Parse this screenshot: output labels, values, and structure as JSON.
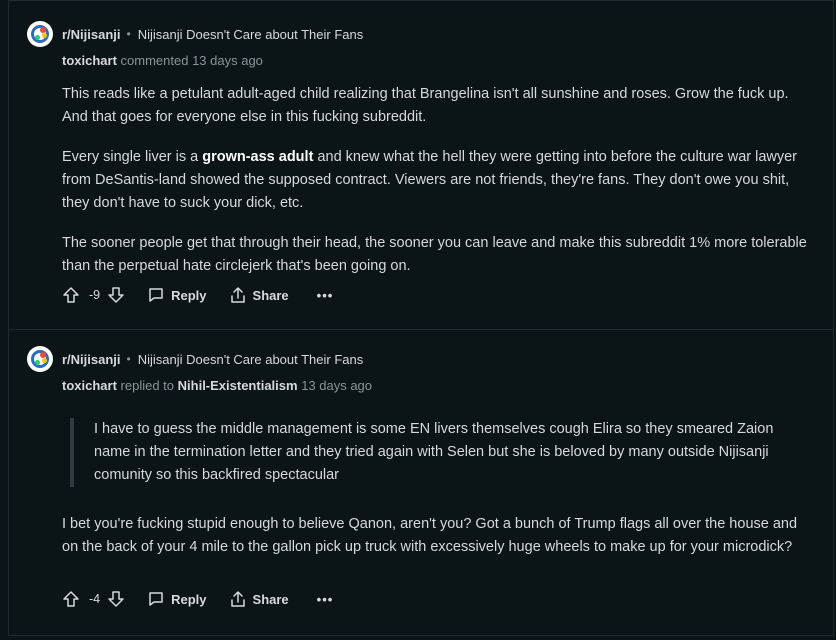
{
  "comments": [
    {
      "subreddit": "r/Nijisanji",
      "separator": "•",
      "post_title": "Nijisanji Doesn't Care about Their Fans",
      "author": "toxichart",
      "action": "commented",
      "target": "",
      "time": "13 days ago",
      "quote": [],
      "paragraphs": [
        {
          "before": "This reads like a petulant adult-aged child realizing that Brangelina isn't all sunshine and roses. Grow the fuck up. And that goes for everyone else in this fucking subreddit.",
          "bold": "",
          "after": ""
        },
        {
          "before": "Every single liver is a ",
          "bold": "grown-ass adult",
          "after": " and knew what the hell they were getting into before the culture war lawyer from DeSantis-land showed the supposed contract. Viewers are not friends, they're fans. They don't owe you shit, they don't have to suck your dick, etc."
        },
        {
          "before": "The sooner people get that through their head, the sooner you can leave and make this subreddit 1% more tolerable than the perpetual hate circlejerk that's been going on.",
          "bold": "",
          "after": ""
        }
      ],
      "score": "-9",
      "reply_label": "Reply",
      "share_label": "Share",
      "more_label": "•••"
    },
    {
      "subreddit": "r/Nijisanji",
      "separator": "•",
      "post_title": "Nijisanji Doesn't Care about Their Fans",
      "author": "toxichart",
      "action": "replied to",
      "target": "Nihil-Existentialism",
      "time": "13 days ago",
      "quote": [
        "I have to guess the middle management is some EN livers themselves cough Elira so they smeared Zaion name in the termination letter and they tried again with Selen but she is beloved by many outside Nijisanji comunity so this backfired spectacular"
      ],
      "paragraphs": [
        {
          "before": "I bet you're fucking stupid enough to believe Qanon, aren't you? Got a bunch of Trump flags all over the house and on the back of your 4 mile to the gallon pick up truck with excessively huge wheels to make up for your microdick?",
          "bold": "",
          "after": ""
        }
      ],
      "score": "-4",
      "reply_label": "Reply",
      "share_label": "Share",
      "more_label": "•••"
    }
  ],
  "icons": {
    "upvote": "upvote-icon",
    "downvote": "downvote-icon",
    "reply": "comment-bubble-icon",
    "share": "share-icon",
    "more": "more-horizontal-icon"
  },
  "colors": {
    "background": "#0b1416",
    "text": "#d7dadc",
    "muted": "#8a9598",
    "border": "#1e2a2d"
  }
}
